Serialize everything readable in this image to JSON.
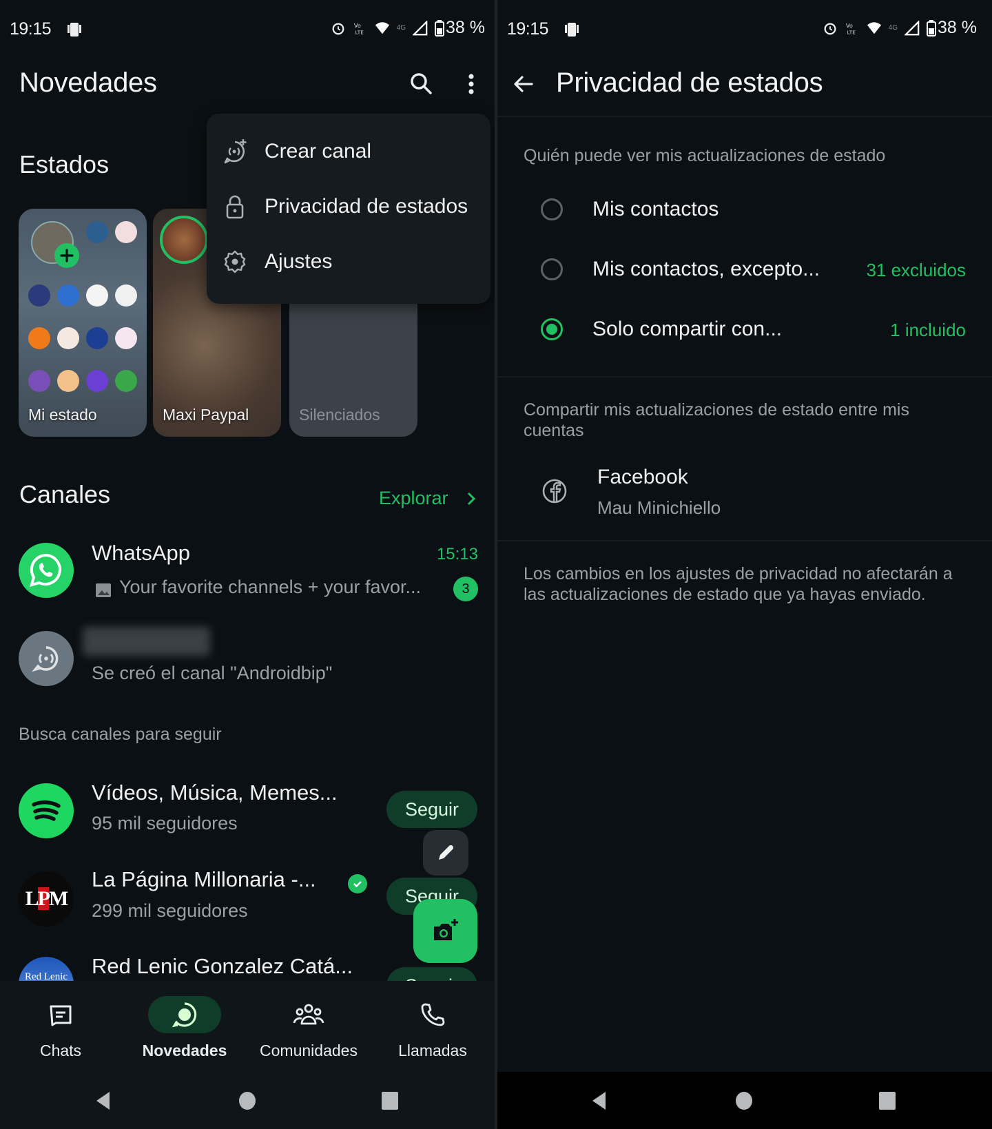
{
  "status_bar": {
    "time": "19:15",
    "battery": "38 %",
    "network": "4G"
  },
  "left": {
    "header": {
      "title": "Novedades"
    },
    "overflow_menu": {
      "items": [
        {
          "label": "Crear canal",
          "icon": "create-channel-icon"
        },
        {
          "label": "Privacidad de estados",
          "icon": "lock-icon"
        },
        {
          "label": "Ajustes",
          "icon": "gear-icon"
        }
      ]
    },
    "estados": {
      "title": "Estados",
      "cards": [
        {
          "label": "Mi estado"
        },
        {
          "label": "Maxi Paypal"
        },
        {
          "label": "Silenciados"
        }
      ]
    },
    "canales": {
      "title": "Canales",
      "explore_label": "Explorar",
      "followed": [
        {
          "name": "WhatsApp",
          "time": "15:13",
          "preview": "Your favorite channels + your favor...",
          "unread": "3"
        },
        {
          "name": "",
          "preview": "Se creó el canal \"Androidbip\""
        }
      ],
      "suggest_title": "Busca canales para seguir",
      "suggested": [
        {
          "name": "Vídeos, Música, Memes...",
          "followers": "95 mil seguidores",
          "button": "Seguir"
        },
        {
          "name": "La Página Millonaria -...",
          "followers": "299 mil seguidores",
          "button": "Seguir",
          "verified": true
        },
        {
          "name": "Red Lenic Gonzalez Catá...",
          "followers": "",
          "button": "Seguir"
        }
      ]
    },
    "bottom_nav": {
      "active": "Novedades",
      "items": [
        {
          "label": "Chats"
        },
        {
          "label": "Novedades"
        },
        {
          "label": "Comunidades"
        },
        {
          "label": "Llamadas"
        }
      ]
    }
  },
  "right": {
    "header": {
      "title": "Privacidad de estados"
    },
    "who_can_see_label": "Quién puede ver mis actualizaciones de estado",
    "options": [
      {
        "label": "Mis contactos",
        "meta": "",
        "selected": false
      },
      {
        "label": "Mis contactos, excepto...",
        "meta": "31 excluidos",
        "selected": false
      },
      {
        "label": "Solo compartir con...",
        "meta": "1 incluido",
        "selected": true
      }
    ],
    "share_label": "Compartir mis actualizaciones de estado entre mis cuentas",
    "account": {
      "service": "Facebook",
      "name": "Mau Minichiello"
    },
    "footer_note": "Los cambios en los ajustes de privacidad no afectarán a las actualizaciones de estado que ya hayas enviado."
  },
  "colors": {
    "accent": "#21c063",
    "background": "#0b1014",
    "chip": "#103d2a"
  }
}
